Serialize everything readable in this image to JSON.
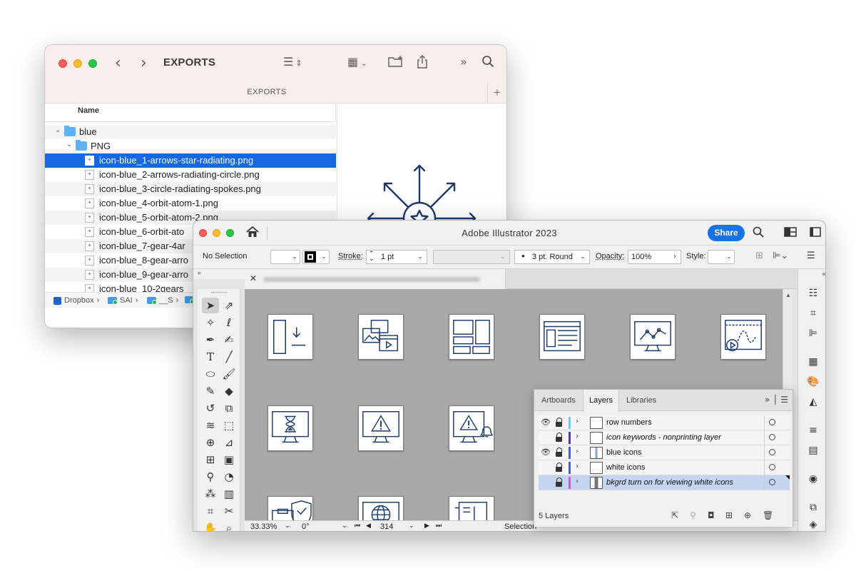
{
  "finder": {
    "title": "EXPORTS",
    "path_label": "EXPORTS",
    "column_name": "Name",
    "rows": [
      {
        "indent": 0,
        "kind": "folder",
        "expanded": true,
        "name": "blue"
      },
      {
        "indent": 1,
        "kind": "folder",
        "expanded": true,
        "name": "PNG"
      },
      {
        "indent": 2,
        "kind": "file",
        "name": "icon-blue_1-arrows-star-radiating.png",
        "selected": true
      },
      {
        "indent": 2,
        "kind": "file",
        "name": "icon-blue_2-arrows-radiating-circle.png"
      },
      {
        "indent": 2,
        "kind": "file",
        "name": "icon-blue_3-circle-radiating-spokes.png"
      },
      {
        "indent": 2,
        "kind": "file",
        "name": "icon-blue_4-orbit-atom-1.png"
      },
      {
        "indent": 2,
        "kind": "file",
        "name": "icon-blue_5-orbit-atom-2.png"
      },
      {
        "indent": 2,
        "kind": "file",
        "name": "icon-blue_6-orbit-ato"
      },
      {
        "indent": 2,
        "kind": "file",
        "name": "icon-blue_7-gear-4ar"
      },
      {
        "indent": 2,
        "kind": "file",
        "name": "icon-blue_8-gear-arro"
      },
      {
        "indent": 2,
        "kind": "file",
        "name": "icon-blue_9-gear-arro"
      },
      {
        "indent": 2,
        "kind": "file",
        "name": "icon-blue_10-2gears"
      }
    ],
    "breadcrumb": [
      "Dropbox",
      "SAI",
      "__S"
    ],
    "preview_icon": "arrows-star-radiating-icon",
    "accent": "#1667e4"
  },
  "illustrator": {
    "app_title": "Adobe Illustrator 2023",
    "share_label": "Share",
    "control": {
      "selection": "No Selection",
      "stroke_label": "Stroke:",
      "stroke_value": "1 pt",
      "brush_value": "3 pt. Round",
      "opacity_label": "Opacity:",
      "opacity_value": "100%",
      "style_label": "Style:"
    },
    "status": {
      "zoom": "33.33%",
      "rotation": "0°",
      "artboard": "314",
      "tool": "Selection"
    },
    "artboard_icons": [
      "download-panel-icon",
      "media-windows-icon",
      "layout-grid-icon",
      "browser-list-icon",
      "monitor-line-chart-icon",
      "browser-video-chart-icon",
      "monitor-hourglass-icon",
      "monitor-warning-icon",
      "monitor-warning-bell-icon",
      "clipboard-shield-icon",
      "monitor-globe-icon",
      "device-thermometer-icon"
    ]
  },
  "layers_panel": {
    "tabs": [
      "Artboards",
      "Layers",
      "Libraries"
    ],
    "active_tab": "Layers",
    "layers": [
      {
        "name": "row numbers",
        "visible": true,
        "color": "#4fd6ff",
        "thumb": "plain",
        "italic": false,
        "selected": false
      },
      {
        "name": "icon keywords - nonprinting layer",
        "visible": false,
        "color": "#5b2bd6",
        "thumb": "plain",
        "italic": true,
        "selected": false
      },
      {
        "name": "blue icons",
        "visible": true,
        "color": "#3d5bff",
        "thumb": "striped",
        "italic": false,
        "selected": false
      },
      {
        "name": "white icons",
        "visible": false,
        "color": "#3d5bff",
        "thumb": "plain",
        "italic": false,
        "selected": false
      },
      {
        "name": "bkgrd turn on for viewing white icons",
        "visible": false,
        "color": "#e84ad6",
        "thumb": "dark",
        "italic": true,
        "selected": true
      }
    ],
    "count_label": "5 Layers"
  }
}
